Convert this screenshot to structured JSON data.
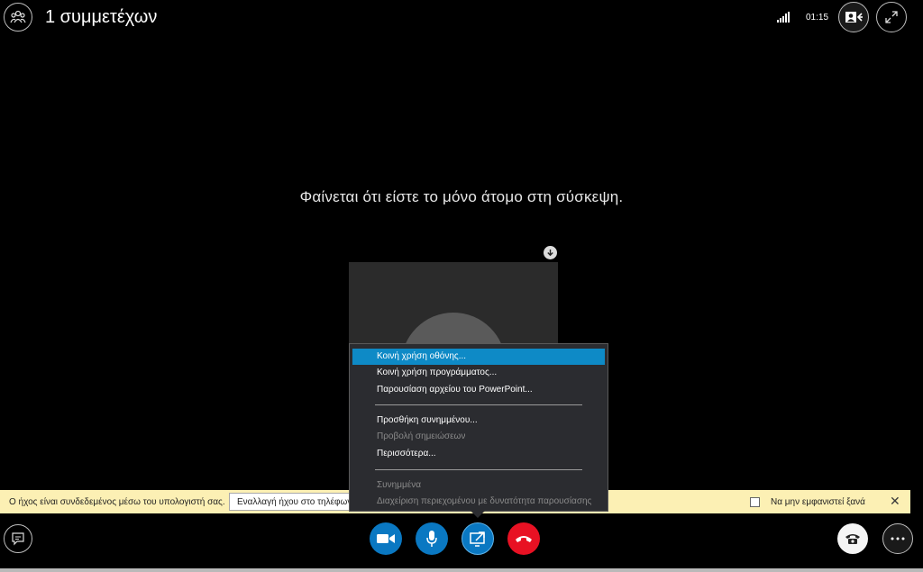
{
  "header": {
    "participants_label": "1 συμμετέχων",
    "timer": "01:15"
  },
  "stage": {
    "empty_message": "Φαίνεται ότι είστε το μόνο άτομο στη σύσκεψη."
  },
  "notification": {
    "text": "Ο ήχος είναι συνδεδεμένος μέσω του υπολογιστή σας.",
    "switch_audio_button": "Εναλλαγή ήχου στο τηλέφωνο",
    "dont_show_label": "Να μην εμφανιστεί ξανά",
    "close_glyph": "✕"
  },
  "share_menu": {
    "items": [
      {
        "label": "Κοινή χρήση οθόνης...",
        "state": "selected"
      },
      {
        "label": "Κοινή χρήση προγράμματος...",
        "state": "enabled"
      },
      {
        "label": "Παρουσίαση αρχείου του PowerPoint...",
        "state": "enabled"
      },
      {
        "label": "Προσθήκη συνημμένου...",
        "state": "enabled"
      },
      {
        "label": "Προβολή σημειώσεων",
        "state": "disabled"
      },
      {
        "label": "Περισσότερα...",
        "state": "enabled"
      },
      {
        "label": "Συνημμένα",
        "state": "disabled"
      },
      {
        "label": "Διαχείριση περιεχομένου με δυνατότητα παρουσίασης",
        "state": "disabled"
      }
    ]
  },
  "colors": {
    "accent_blue": "#0a78c2",
    "menu_highlight": "#0e8ac6",
    "hangup_red": "#e81123",
    "notification_bg": "#fcf0b4"
  },
  "icons": {
    "participants": "people-icon",
    "signal": "signal-strength-icon",
    "pop_out": "contact-card-icon",
    "fullscreen": "expand-icon",
    "chat": "chat-icon",
    "video": "video-camera-icon",
    "mic": "microphone-icon",
    "share": "present-screen-icon",
    "hangup": "hang-up-icon",
    "call_controls": "phone-icon",
    "more": "more-options-icon"
  }
}
